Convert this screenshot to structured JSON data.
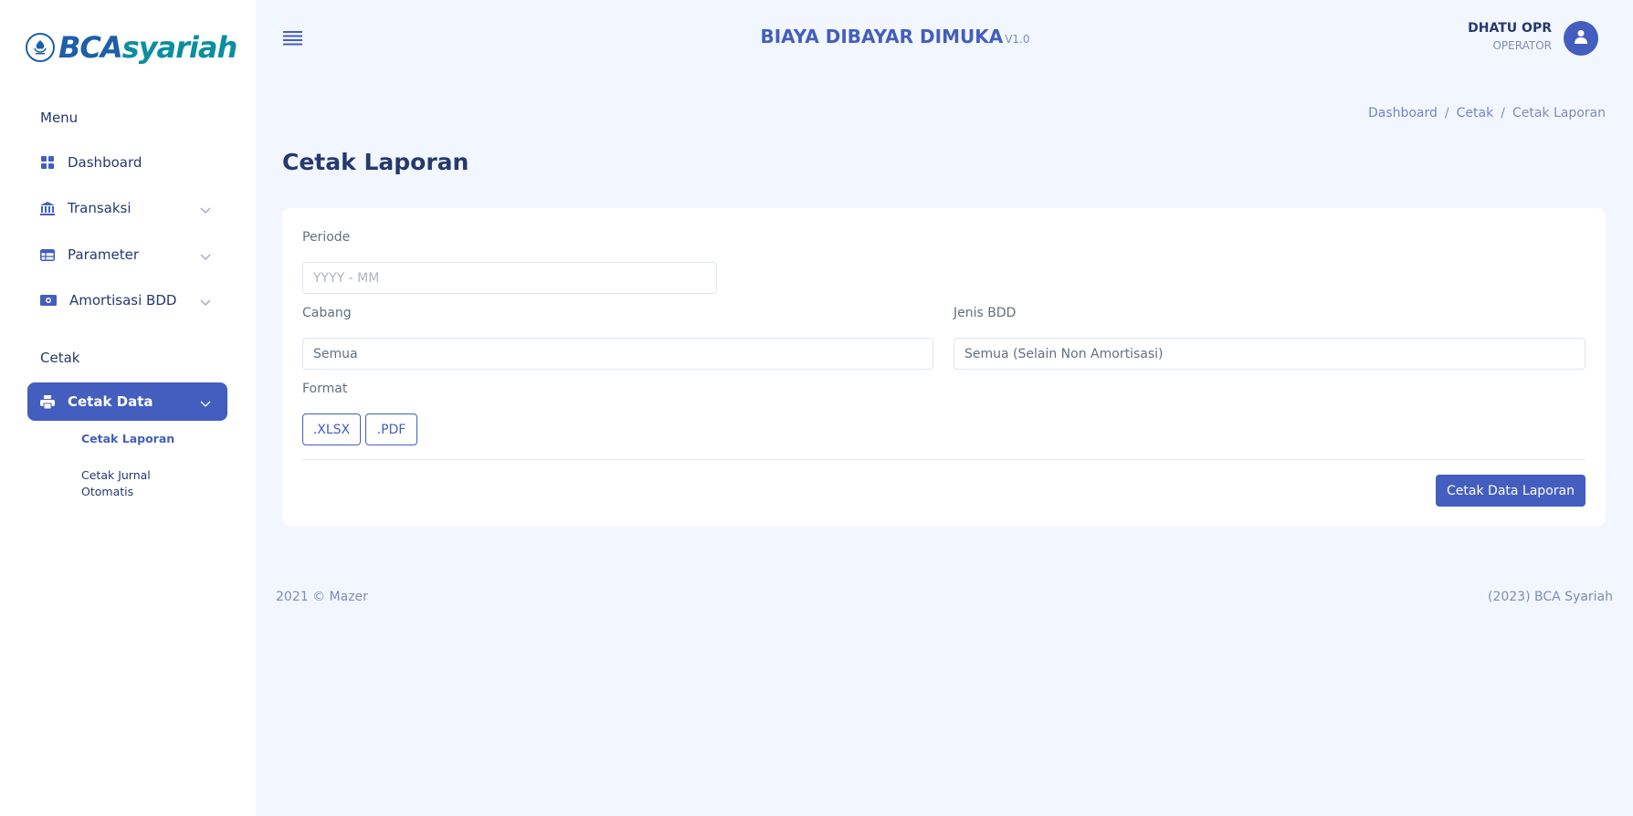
{
  "brand": {
    "logo_text_a": "BCA",
    "logo_text_b": "syariah",
    "logo_icon": "bca-logo-icon",
    "primary_color": "#435ebe"
  },
  "sidebar": {
    "menu_title": "Menu",
    "items": [
      {
        "label": "Dashboard",
        "icon": "grid-icon"
      },
      {
        "label": "Transaksi",
        "icon": "bank-icon"
      },
      {
        "label": "Parameter",
        "icon": "table-icon"
      },
      {
        "label": "Amortisasi BDD",
        "icon": "money-icon"
      }
    ],
    "print_title": "Cetak",
    "print_item": {
      "label": "Cetak Data",
      "icon": "printer-icon"
    },
    "subitems": [
      {
        "label": "Cetak Laporan"
      },
      {
        "label": "Cetak Jurnal",
        "label_2": "Otomatis"
      }
    ]
  },
  "header": {
    "title": "BIAYA DIBAYAR DIMUKA",
    "version": "V1.0",
    "user_name": "DHATU OPR",
    "user_role": "OPERATOR"
  },
  "breadcrumb": [
    "Dashboard",
    "Cetak",
    "Cetak Laporan"
  ],
  "page": {
    "title": "Cetak Laporan"
  },
  "form": {
    "periode_label": "Periode",
    "periode_placeholder": "YYYY - MM",
    "cabang_label": "Cabang",
    "cabang_value": "Semua",
    "jenis_label": "Jenis BDD",
    "jenis_value": "Semua (Selain Non Amortisasi)",
    "format_label": "Format",
    "format_options": [
      ".XLSX",
      ".PDF"
    ],
    "submit_label": "Cetak Data Laporan"
  },
  "footer": {
    "left": "2021 © Mazer",
    "right": "(2023) BCA Syariah"
  }
}
